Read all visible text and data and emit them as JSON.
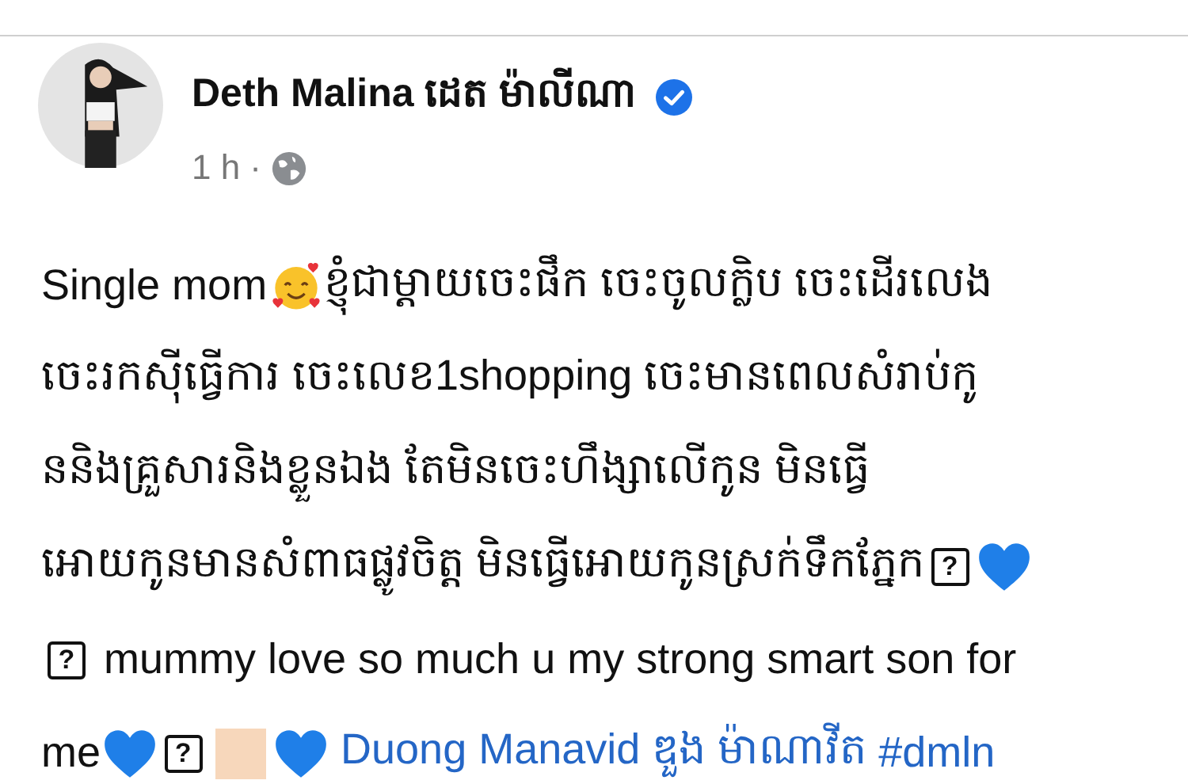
{
  "post": {
    "author": "Deth Malina ដេត ម៉ាលីណា",
    "verified": true,
    "time": "1 h",
    "separator": "·",
    "lines": [
      [
        {
          "kind": "text",
          "text": "Single mom"
        },
        {
          "kind": "smile-hearts"
        },
        {
          "kind": "text",
          "text": "ខ្ញុំជាម្តាយចេះផឹក ចេះចូលក្លិប ចេះដើរលេង"
        }
      ],
      [
        {
          "kind": "text",
          "text": "ចេះរកស៊ីធ្វើការ ចេះលេខ1shopping ចេះមានពេលសំរាប់កូ"
        }
      ],
      [
        {
          "kind": "text",
          "text": "ននិងគ្រួសារនិងខ្លួនឯង តែមិនចេះហឹង្សាលើកូន មិនធ្វើ"
        }
      ],
      [
        {
          "kind": "text",
          "text": "អោយកូនមានសំពាធផ្លូវចិត្ត មិនធ្វើអោយកូនស្រក់ទឹកភ្នែក"
        },
        {
          "kind": "missing",
          "text": "?"
        },
        {
          "kind": "blue-heart"
        }
      ],
      [
        {
          "kind": "missing",
          "text": "?"
        },
        {
          "kind": "text",
          "text": " mummy love so much u my strong smart son for"
        }
      ],
      [
        {
          "kind": "text",
          "text": "me"
        },
        {
          "kind": "blue-heart"
        },
        {
          "kind": "missing",
          "text": "?"
        },
        {
          "kind": "swatch"
        },
        {
          "kind": "blue-heart"
        },
        {
          "kind": "link",
          "text": " Duong Manavid ឌួង ម៉ាណាវីត"
        },
        {
          "kind": "hashtag",
          "text": " #dmln"
        }
      ]
    ]
  }
}
